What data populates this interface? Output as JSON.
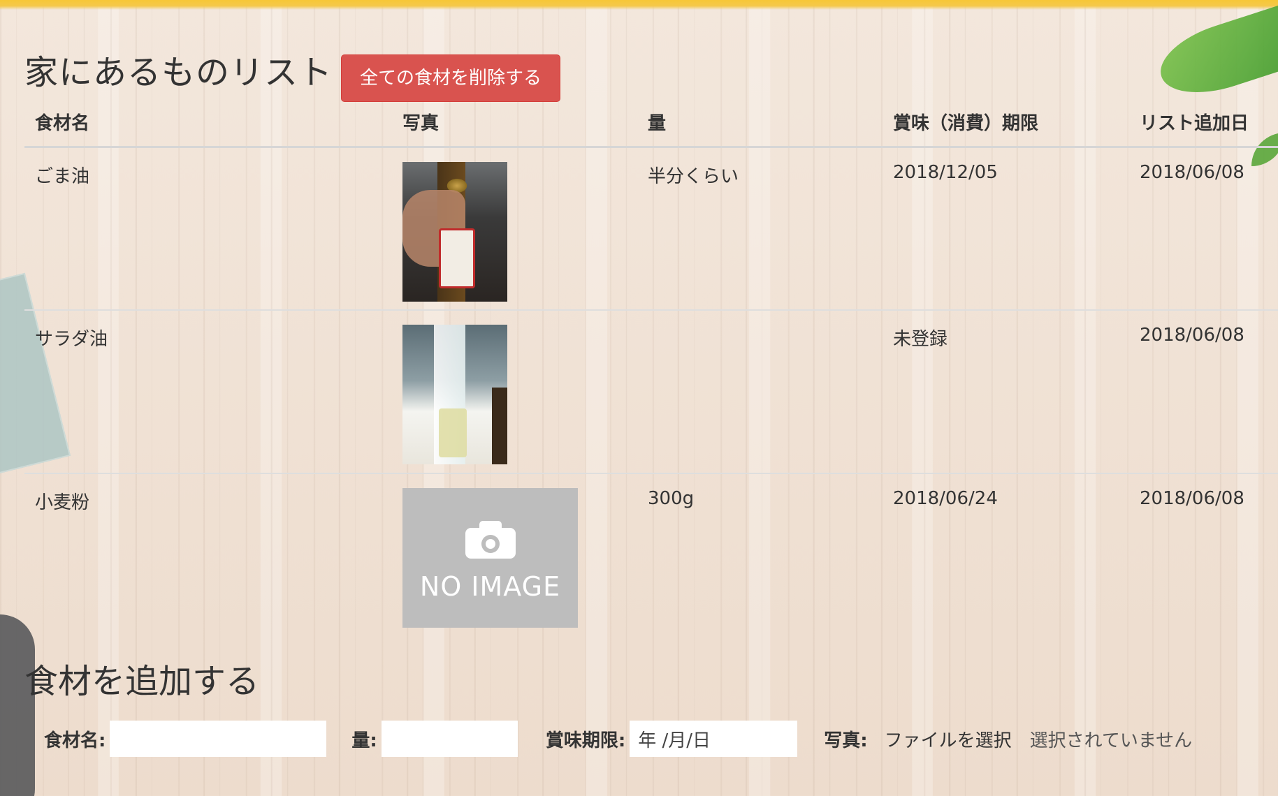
{
  "header": {
    "title": "家にあるものリスト",
    "delete_all_label": "全ての食材を削除する"
  },
  "table": {
    "headers": {
      "name": "食材名",
      "photo": "写真",
      "quantity": "量",
      "expiry": "賞味（消費）期限",
      "added": "リスト追加日"
    },
    "rows": [
      {
        "name": "ごま油",
        "photo": "sesame-oil-photo",
        "quantity": "半分くらい",
        "expiry": "2018/12/05",
        "added": "2018/06/08"
      },
      {
        "name": "サラダ油",
        "photo": "salad-oil-photo",
        "quantity": "",
        "expiry": "未登録",
        "added": "2018/06/08"
      },
      {
        "name": "小麦粉",
        "photo": "no-image",
        "quantity": "300g",
        "expiry": "2018/06/24",
        "added": "2018/06/08"
      }
    ],
    "no_image_text": "NO IMAGE"
  },
  "add_form": {
    "title": "食材を追加する",
    "name_label": "食材名:",
    "name_value": "",
    "quantity_label": "量:",
    "quantity_value": "",
    "expiry_label": "賞味期限:",
    "date_placeholder": "年 /月/日",
    "photo_label": "写真:",
    "file_button_label": "ファイルを選択",
    "file_status": "選択されていません"
  },
  "colors": {
    "top_bar": "#f7c737",
    "danger": "#d9534f",
    "no_image_bg": "#bdbdbd"
  }
}
